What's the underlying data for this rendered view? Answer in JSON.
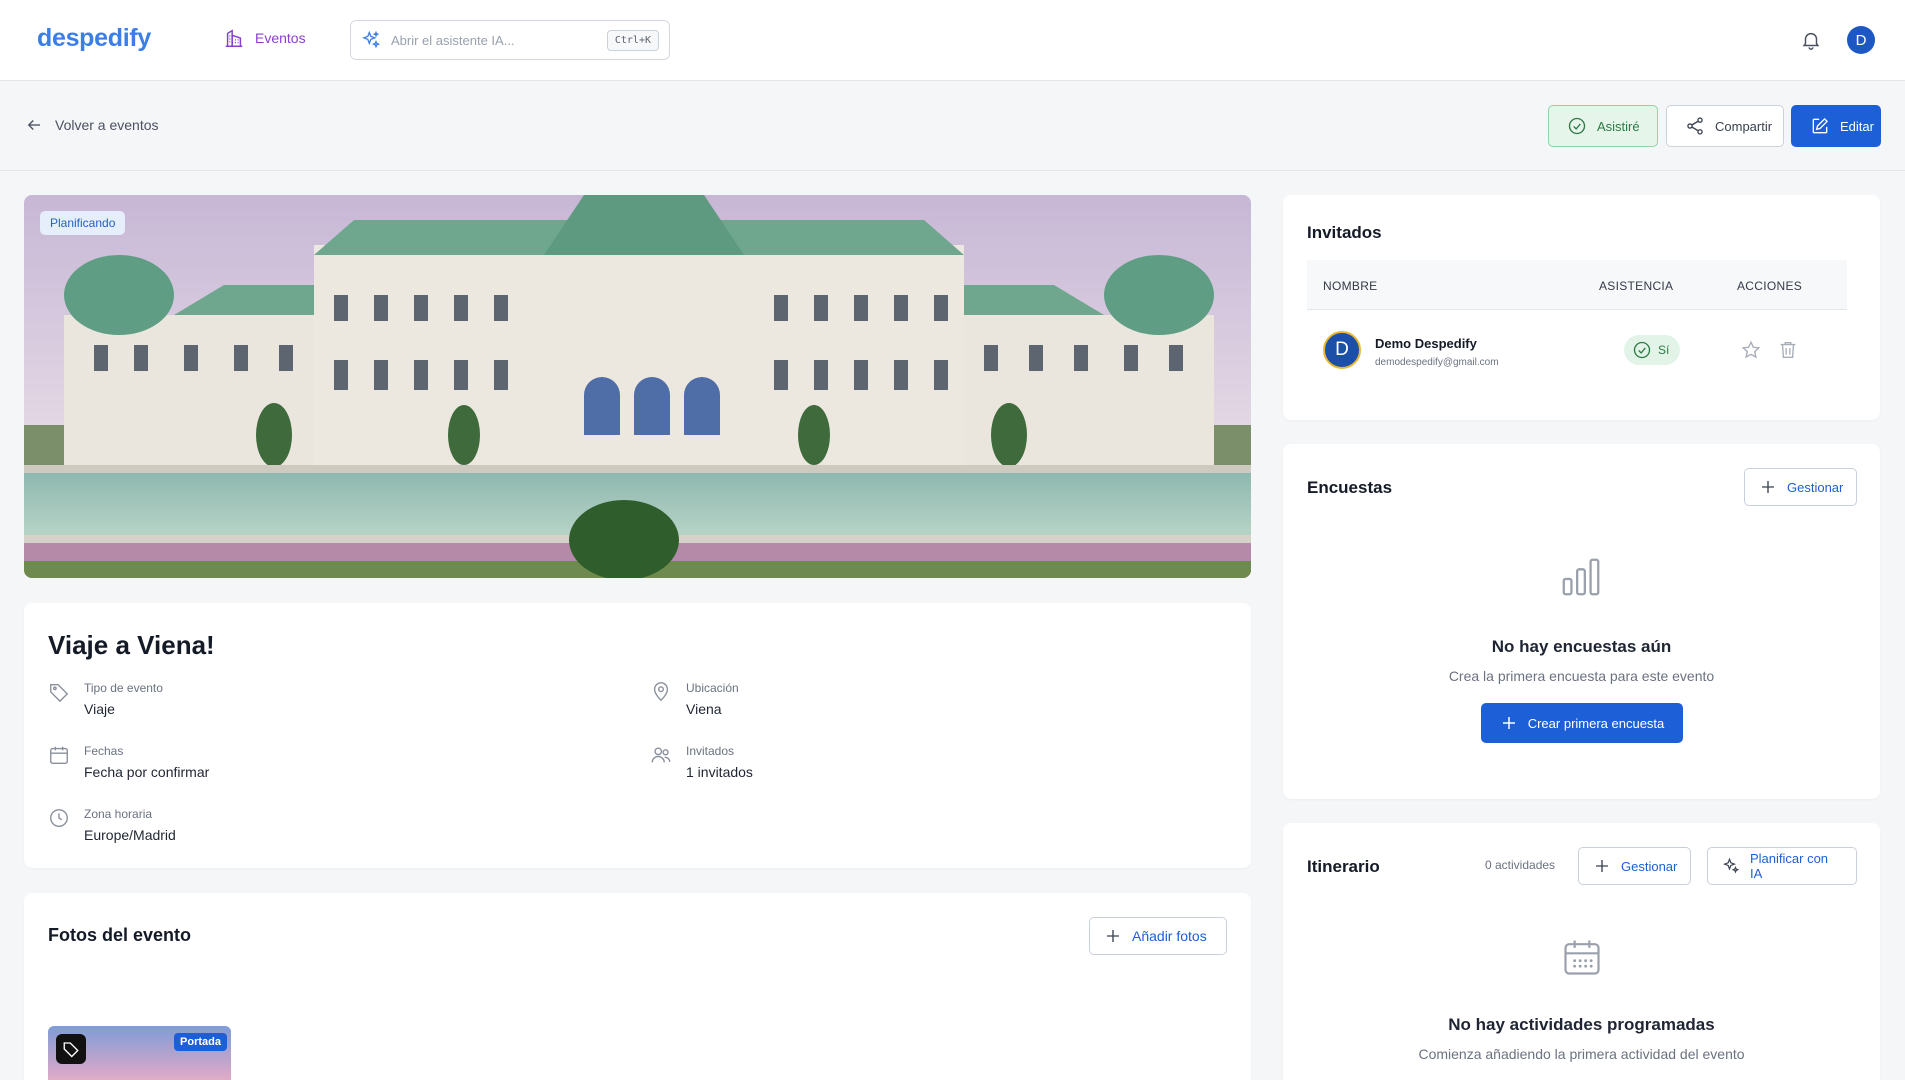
{
  "header": {
    "logo": "despedify",
    "nav_events": "Eventos",
    "ai_search_placeholder": "Abrir el asistente IA...",
    "ai_shortcut": "Ctrl+K",
    "user_initial": "D"
  },
  "subheader": {
    "back_label": "Volver a eventos",
    "attend_label": "Asistiré",
    "share_label": "Compartir",
    "edit_label": "Editar"
  },
  "event": {
    "status_badge": "Planificando",
    "title": "Viaje a Viena!",
    "fields": {
      "type_label": "Tipo de evento",
      "type_value": "Viaje",
      "location_label": "Ubicación",
      "location_value": "Viena",
      "dates_label": "Fechas",
      "dates_value": "Fecha por confirmar",
      "guests_label": "Invitados",
      "guests_value": "1 invitados",
      "tz_label": "Zona horaria",
      "tz_value": "Europe/Madrid"
    }
  },
  "photos": {
    "title": "Fotos del evento",
    "add_label": "Añadir fotos",
    "cover_badge": "Portada"
  },
  "guests": {
    "title": "Invitados",
    "columns": [
      "NOMBRE",
      "ASISTENCIA",
      "ACCIONES"
    ],
    "rows": [
      {
        "initial": "D",
        "name": "Demo Despedify",
        "email": "demodespedify@gmail.com",
        "attendance": "Sí"
      }
    ]
  },
  "surveys": {
    "title": "Encuestas",
    "manage_label": "Gestionar",
    "empty_title": "No hay encuestas aún",
    "empty_sub": "Crea la primera encuesta para este evento",
    "create_label": "Crear primera encuesta"
  },
  "itinerary": {
    "title": "Itinerario",
    "count": "0 actividades",
    "manage_label": "Gestionar",
    "plan_ai_label": "Planificar con IA",
    "empty_title": "No hay actividades programadas",
    "empty_sub": "Comienza añadiendo la primera actividad del evento"
  },
  "colors": {
    "brand": "#3c7ee8",
    "primary": "#1d5fd6",
    "nav_active": "#8b3fd0",
    "success": "#2d7a45"
  }
}
